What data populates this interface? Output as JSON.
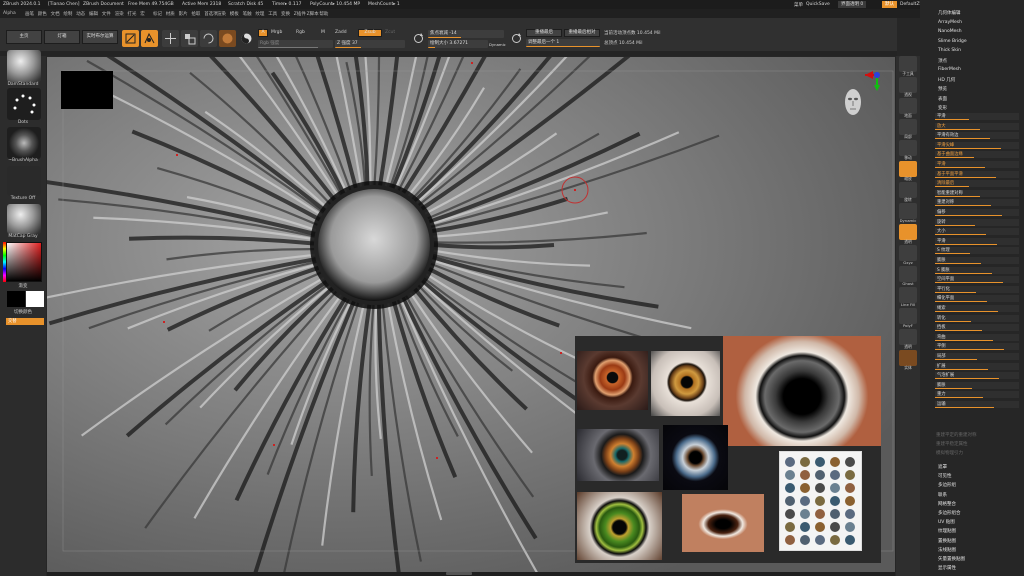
{
  "titlebar": {
    "app": "ZBrush 2024.0.1",
    "author": "[Tianao Chen]",
    "doc": "ZBrush Document",
    "free_mem": "Free Mem 49.754GB",
    "active_mem": "Active Mem 2318",
    "scratch": "Scratch Disk 45",
    "timer": "Timer▸ 0.117",
    "poly": "PolyCount▸ 10.454 MP",
    "mesh": "MeshCount▸ 1",
    "menu": "菜单",
    "quicksave": "QuickSave",
    "transparency": "界面透明 0",
    "default_btn": "默认",
    "script": "DefaultZScript"
  },
  "menubar": [
    "Alpha",
    "画笔",
    "颜色",
    "文档",
    "绘制",
    "动态",
    "编辑",
    "文件",
    "渲染",
    "打光",
    "宏",
    "标记",
    "材质",
    "影片",
    "拾取",
    "首选项",
    "渲染",
    "模板",
    "笔触",
    "纹理",
    "工具",
    "变换",
    "Z插件",
    "Z脚本",
    "帮助"
  ],
  "coords": "0.095,0.031,-0.040",
  "toolbar": {
    "home": "主页",
    "lightbox": "灯箱",
    "liveboolean": "实时布尔运算",
    "edit": "编辑",
    "draw": "绘制",
    "move": "移动",
    "scale": "缩放",
    "rotate": "旋转",
    "a_label": "A",
    "mrgb": "Mrgb",
    "rgb": "Rgb",
    "m": "M",
    "zadd": "Zadd",
    "zsub": "Zsub",
    "zcut": "Zcut",
    "rgb_intensity": "Rgb 强度",
    "z_intensity": "Z 强度 37",
    "focal_shift": "焦点衰减 -14",
    "draw_size": "绘制大小 3.67271",
    "dynamic": "Dynamic",
    "replay_last": "重播最后",
    "replay_last_rel": "重播最后相对",
    "active_points": "当前活动顶点数 10.454 Mil",
    "adjust_last": "调整最后一个 1",
    "total_points": "总顶点 10.454 Mil"
  },
  "leftshelf": {
    "brush": "DamStandard",
    "stroke": "Dots",
    "alpha": "~BrushAlpha",
    "texture": "Texture Off",
    "material": "MatCap Gray",
    "gradient": "渐变",
    "switch_color": "切换颜色",
    "alternate": "交替"
  },
  "rightshelf": [
    "子工具",
    "透视",
    "地面",
    "局部",
    "移动",
    "缩放",
    "旋转",
    "Dynamic",
    "透明",
    "Gxyz",
    "Ghost",
    "Line Fill",
    "PolyF",
    "透明",
    "实体"
  ],
  "rightpanel": {
    "top_items": [
      "几何体编辑",
      "ArrayMesh",
      "NanoMesh",
      "Slime Bridge",
      "Thick Skin",
      "顶点",
      "FiberMesh",
      "HD 几何",
      "预览",
      "表面",
      "变形"
    ],
    "sub_items": [
      "平滑",
      "放大",
      "平滑有效边",
      "平滑尖峰",
      "基于曲面边缘",
      "平滑",
      "基于平面平滑",
      "清除最后",
      "智能重建对称",
      "重建对称",
      "偏移",
      "旋转",
      "大小",
      "平滑",
      "S 纹理",
      "膨胀",
      "S 膨胀",
      "空间平面",
      "平行化",
      "细化平面",
      "绳索",
      "转化",
      "挡板",
      "弯曲",
      "平侧",
      "局部",
      "扩展",
      "气泡扩展",
      "膨胀",
      "重力",
      "运输"
    ],
    "bottom_items": [
      "遮罩",
      "可见性",
      "多边形组",
      "联系",
      "网格整合",
      "多边形组合",
      "UV 贴图",
      "纹理贴图",
      "置换贴图",
      "法线贴图",
      "矢量置换贴图",
      "显示属性"
    ],
    "disabled_items": [
      "重建平定的重建对称",
      "重建平稳定属性",
      "模拟物理引力"
    ]
  },
  "colors": {
    "accent": "#e8922b",
    "panel": "#303030",
    "viewport_bg": "#7c7c7c"
  }
}
